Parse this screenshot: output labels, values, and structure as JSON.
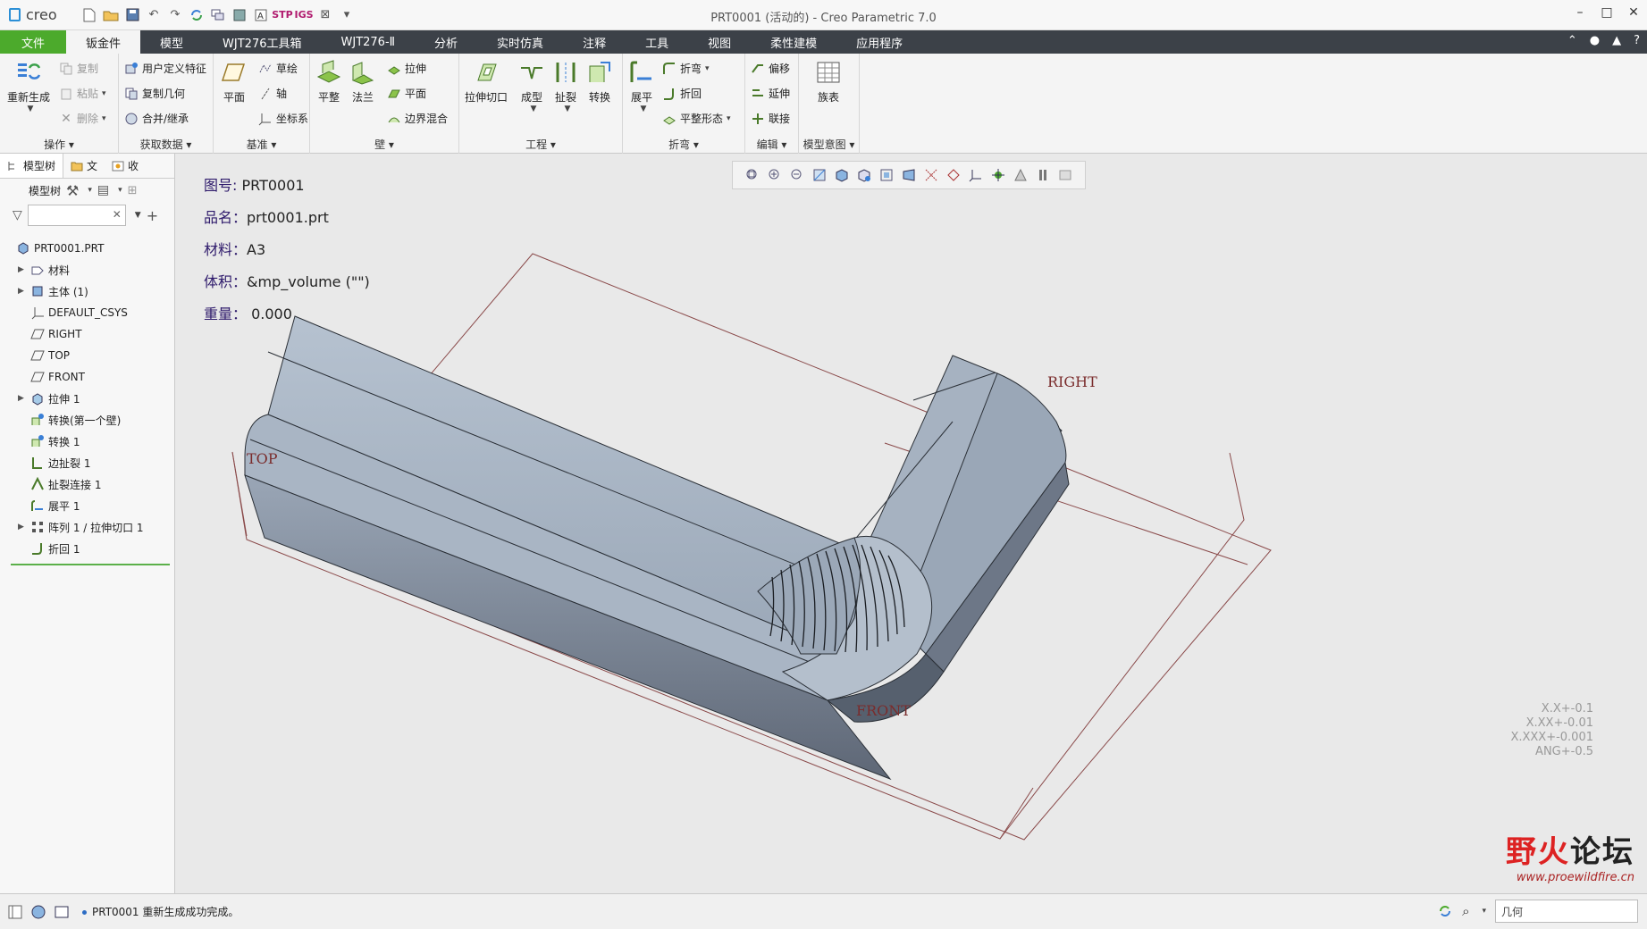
{
  "app": {
    "logo_text": "creo",
    "window_title": "PRT0001 (活动的) - Creo Parametric 7.0"
  },
  "ribbon_tabs": [
    "文件",
    "钣金件",
    "模型",
    "WJT276工具箱",
    "WJT276-Ⅱ",
    "分析",
    "实时仿真",
    "注释",
    "工具",
    "视图",
    "柔性建模",
    "应用程序"
  ],
  "ribbon": {
    "operations": {
      "regenerate": "重新生成",
      "copy": "复制",
      "paste": "粘贴",
      "delete": "删除",
      "label": "操作"
    },
    "get_data": {
      "udf": "用户定义特征",
      "copy_geom": "复制几何",
      "merge": "合并/继承",
      "label": "获取数据"
    },
    "datum": {
      "plane": "平面",
      "sketch": "草绘",
      "axis": "轴",
      "csys": "坐标系",
      "label": "基准"
    },
    "wall": {
      "flat": "平整",
      "flange": "法兰",
      "extrude": "拉伸",
      "planar": "平面",
      "blend": "边界混合",
      "label": "壁"
    },
    "engineering": {
      "extrude_cut": "拉伸切口",
      "form": "成型",
      "rip": "扯裂",
      "convert": "转换",
      "label": "工程"
    },
    "bends": {
      "unbend": "展平",
      "bend": "折弯",
      "bend_back": "折回",
      "flatten_form": "平整形态",
      "label": "折弯"
    },
    "editing": {
      "offset": "偏移",
      "extend": "延伸",
      "join": "联接",
      "label": "编辑"
    },
    "model_intent": {
      "family_table": "族表",
      "label": "模型意图"
    }
  },
  "left_panel": {
    "tabs": [
      "模型树",
      "文",
      "收"
    ],
    "tree_header": "模型树",
    "search_placeholder": "",
    "items": [
      {
        "label": "PRT0001.PRT",
        "icon": "part-icon",
        "expandable": false,
        "root": true
      },
      {
        "label": "材料",
        "icon": "material-icon",
        "expandable": true
      },
      {
        "label": "主体 (1)",
        "icon": "body-icon",
        "expandable": true
      },
      {
        "label": "DEFAULT_CSYS",
        "icon": "csys-icon",
        "expandable": false
      },
      {
        "label": "RIGHT",
        "icon": "datum-plane-icon",
        "expandable": false
      },
      {
        "label": "TOP",
        "icon": "datum-plane-icon",
        "expandable": false
      },
      {
        "label": "FRONT",
        "icon": "datum-plane-icon",
        "expandable": false
      },
      {
        "label": "拉伸 1",
        "icon": "extrude-icon",
        "expandable": true
      },
      {
        "label": "转换(第一个壁)",
        "icon": "convert-icon",
        "expandable": false
      },
      {
        "label": "转换 1",
        "icon": "convert-icon",
        "expandable": false
      },
      {
        "label": "边扯裂 1",
        "icon": "edge-rip-icon",
        "expandable": false
      },
      {
        "label": "扯裂连接 1",
        "icon": "rip-connect-icon",
        "expandable": false
      },
      {
        "label": "展平 1",
        "icon": "unbend-icon",
        "expandable": false
      },
      {
        "label": "阵列 1 / 拉伸切口 1",
        "icon": "pattern-icon",
        "expandable": true
      },
      {
        "label": "折回 1",
        "icon": "bend-back-icon",
        "expandable": false
      }
    ]
  },
  "annotations": {
    "drawing_no": {
      "label": "图号:",
      "value": "PRT0001"
    },
    "name": {
      "label": "品名：",
      "value": "prt0001.prt"
    },
    "material": {
      "label": "材料：",
      "value": "A3"
    },
    "volume": {
      "label": "体积：",
      "value": "&mp_volume (\"\")"
    },
    "weight": {
      "label": "重量：",
      "value": "0.000"
    }
  },
  "datum_labels": {
    "right": "RIGHT",
    "top": "TOP",
    "front": "FRONT"
  },
  "tolerances": [
    "X.X+-0.1",
    "X.XX+-0.01",
    "X.XXX+-0.001",
    "ANG+-0.5"
  ],
  "watermark": {
    "text_black_1": "野",
    "text_red": "火",
    "text_black_2": "论坛",
    "url": "www.proewildfire.cn"
  },
  "status": {
    "message": "PRT0001 重新生成成功完成。",
    "filter_value": "几何"
  },
  "colors": {
    "file_tab": "#4caa2c",
    "tab_bar": "#3c4148",
    "model_face": "#a8b4c3",
    "datum": "#7a2c2c"
  }
}
